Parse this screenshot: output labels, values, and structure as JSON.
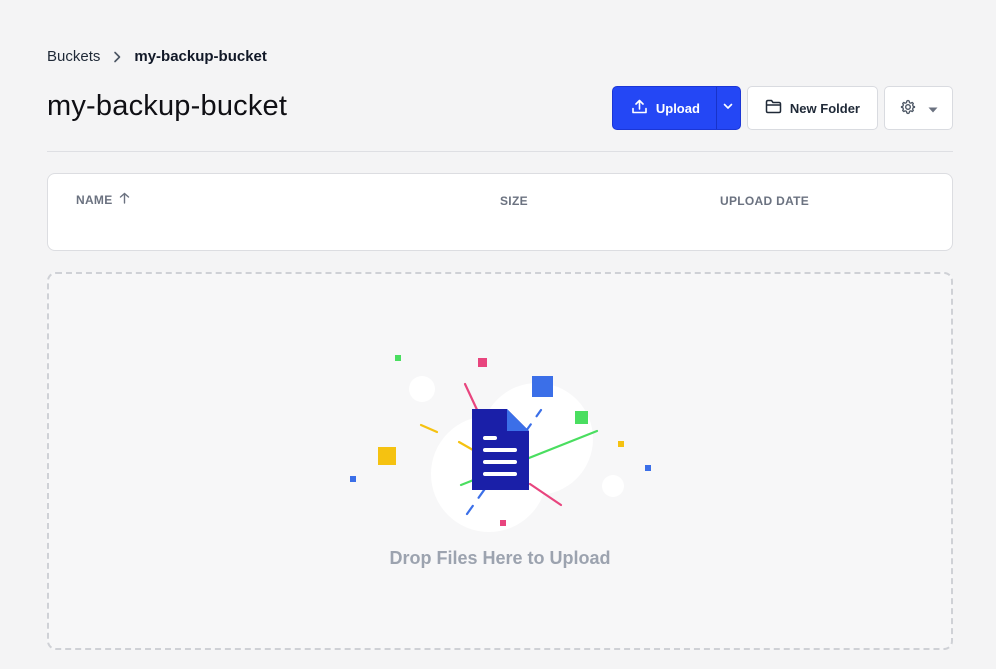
{
  "breadcrumb": {
    "root": "Buckets",
    "current": "my-backup-bucket"
  },
  "page_title": "my-backup-bucket",
  "toolbar": {
    "upload_label": "Upload",
    "new_folder_label": "New Folder",
    "accent": "#2447f5"
  },
  "table": {
    "columns": [
      "NAME",
      "SIZE",
      "UPLOAD DATE"
    ],
    "sort_column": "NAME",
    "sort_direction": "ascending",
    "rows": []
  },
  "dropzone": {
    "text": "Drop Files Here to Upload"
  },
  "icons": {
    "breadcrumb_separator": "chevron-right-icon",
    "upload": "upload-icon",
    "upload_menu": "chevron-down-icon",
    "new_folder": "folder-icon",
    "settings": "gear-icon",
    "settings_menu": "caret-down-icon",
    "sort": "arrow-up-icon",
    "illustration": "document-icon"
  }
}
